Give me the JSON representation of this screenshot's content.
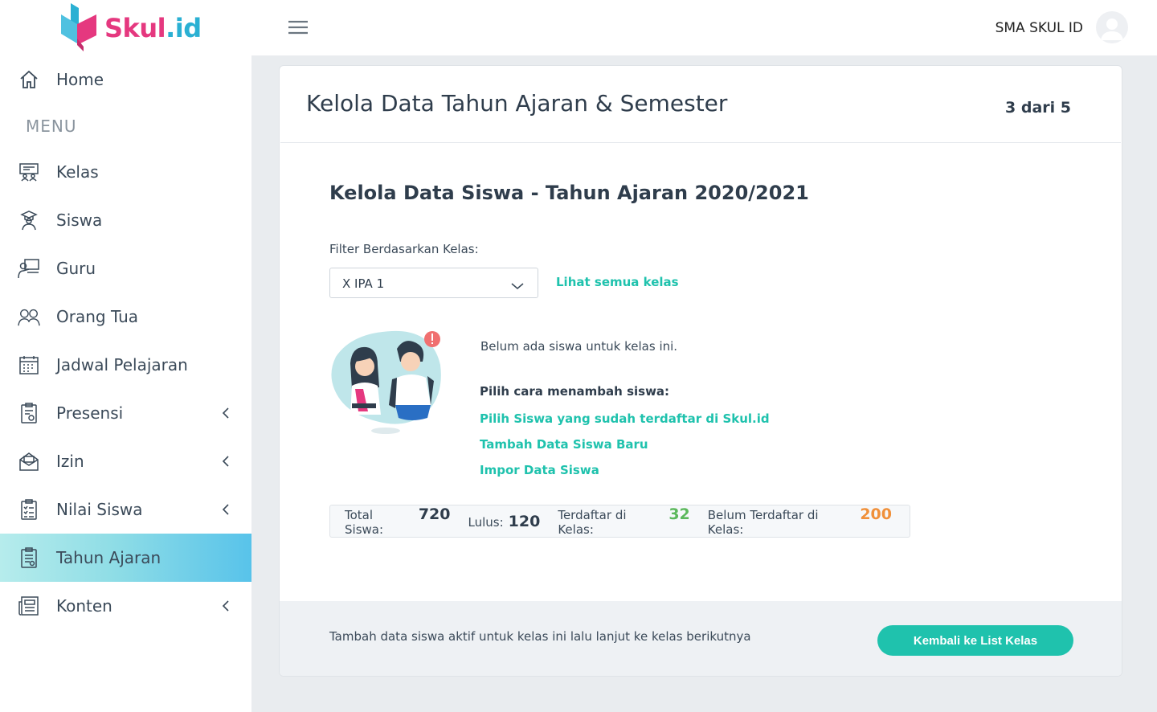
{
  "brand": {
    "part1": "Skul",
    "part2": ".id",
    "pink": "#e5387f",
    "blue": "#2ab0d3"
  },
  "topbar": {
    "school_name": "SMA SKUL ID",
    "menu_icon": "hamburger-icon",
    "avatar_icon": "user-avatar-icon"
  },
  "sidebar": {
    "home": {
      "label": "Home",
      "icon": "home-icon"
    },
    "menu_heading": "MENU",
    "items": [
      {
        "label": "Kelas",
        "icon": "classroom-icon",
        "has_submenu": false
      },
      {
        "label": "Siswa",
        "icon": "student-icon",
        "has_submenu": false
      },
      {
        "label": "Guru",
        "icon": "teacher-icon",
        "has_submenu": false
      },
      {
        "label": "Orang Tua",
        "icon": "parents-icon",
        "has_submenu": false
      },
      {
        "label": "Jadwal Pelajaran",
        "icon": "calendar-icon",
        "has_submenu": false
      },
      {
        "label": "Presensi",
        "icon": "attendance-icon",
        "has_submenu": true
      },
      {
        "label": "Izin",
        "icon": "envelope-icon",
        "has_submenu": true
      },
      {
        "label": "Nilai Siswa",
        "icon": "checklist-icon",
        "has_submenu": true
      },
      {
        "label": "Tahun Ajaran",
        "icon": "clipboard-icon",
        "has_submenu": false,
        "active": true
      },
      {
        "label": "Konten",
        "icon": "newspaper-icon",
        "has_submenu": true
      }
    ]
  },
  "card": {
    "title": "Kelola Data Tahun Ajaran & Semester",
    "step": "3 dari 5",
    "section_title": "Kelola Data Siswa - Tahun Ajaran 2020/2021",
    "filter": {
      "label": "Filter Berdasarkan Kelas:",
      "selected": "X IPA 1",
      "see_all": "Lihat semua kelas"
    },
    "empty": {
      "message": "Belum ada siswa untuk kelas ini.",
      "choose_label": "Pilih cara menambah siswa:",
      "actions": [
        "Pilih Siswa yang sudah terdaftar di Skul.id",
        "Tambah Data Siswa Baru",
        "Impor Data Siswa"
      ]
    },
    "stats": [
      {
        "label": "Total Siswa:",
        "value": "720",
        "color": "#2f3d4c"
      },
      {
        "label": "Lulus:",
        "value": "120",
        "color": "#2f3d4c"
      },
      {
        "label": "Terdaftar di Kelas:",
        "value": "32",
        "color": "#5cb85c"
      },
      {
        "label": "Belum Terdaftar di Kelas:",
        "value": "200",
        "color": "#f0903a"
      }
    ],
    "footer": {
      "text": "Tambah data siswa aktif untuk kelas ini lalu lanjut ke kelas berikutnya",
      "button": "Kembali ke List Kelas"
    }
  },
  "colors": {
    "accent": "#1fc2ad",
    "text": "#2f3d4c"
  }
}
